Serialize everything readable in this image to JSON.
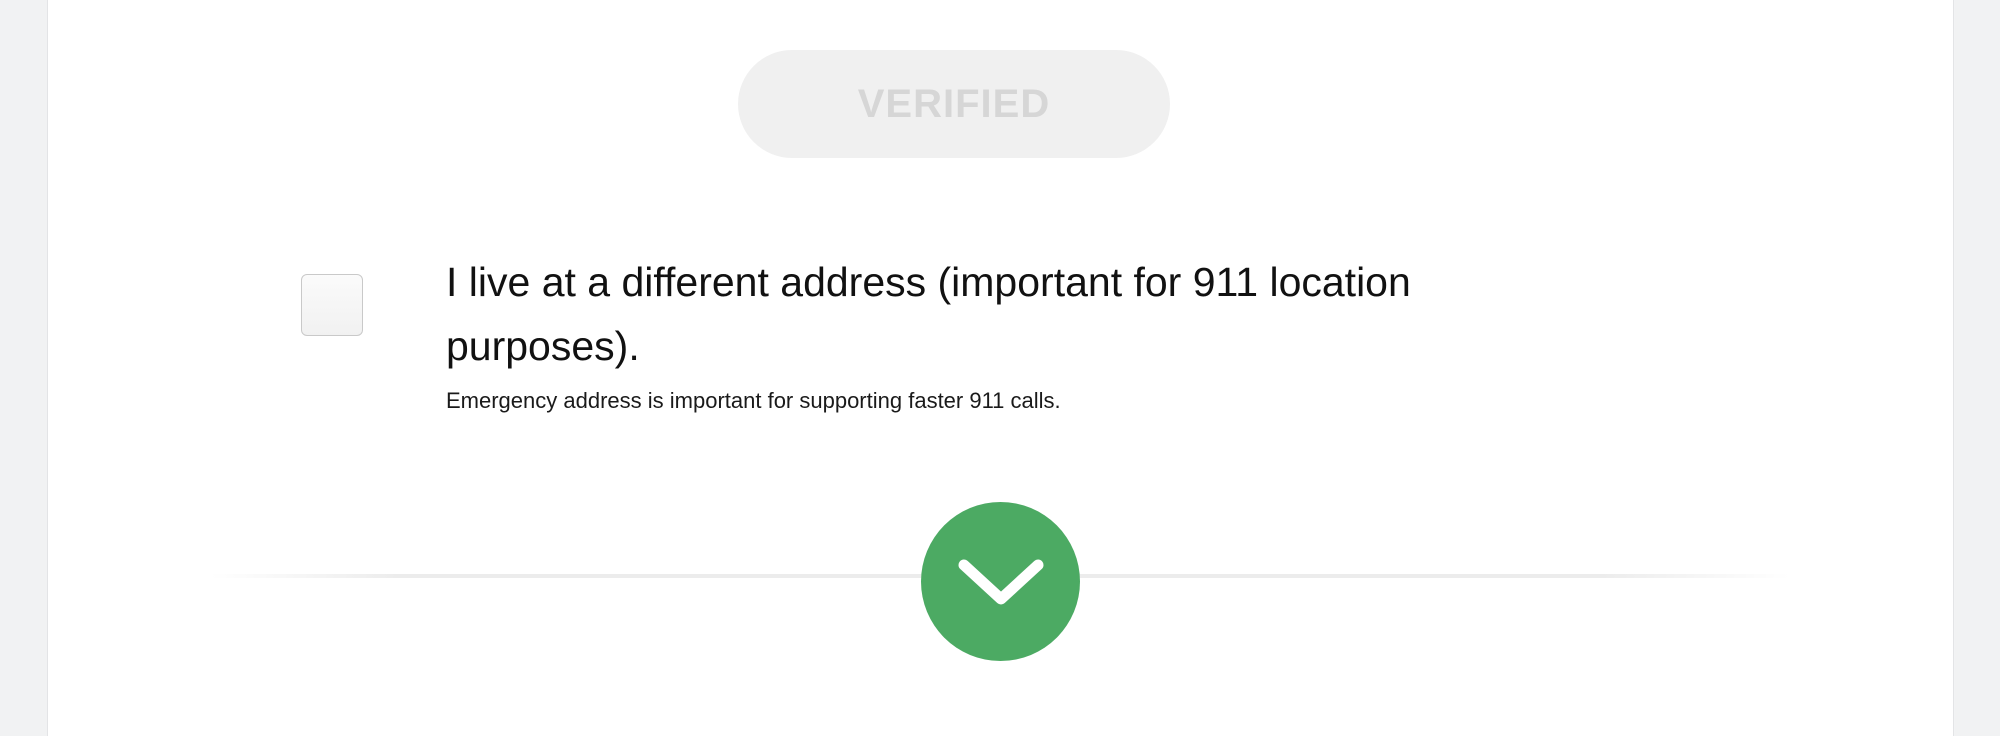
{
  "verify": {
    "status_label": "VERIFIED"
  },
  "address_option": {
    "checked": false,
    "label": "I live at a different address (important for 911 location purposes).",
    "hint": "Emergency address is important for supporting faster 911 calls."
  },
  "navigation": {
    "next_icon": "chevron-down-icon"
  },
  "colors": {
    "accent_green": "#4caa63",
    "verified_bg": "#f0f0f0",
    "verified_text": "#d6d6d6"
  }
}
